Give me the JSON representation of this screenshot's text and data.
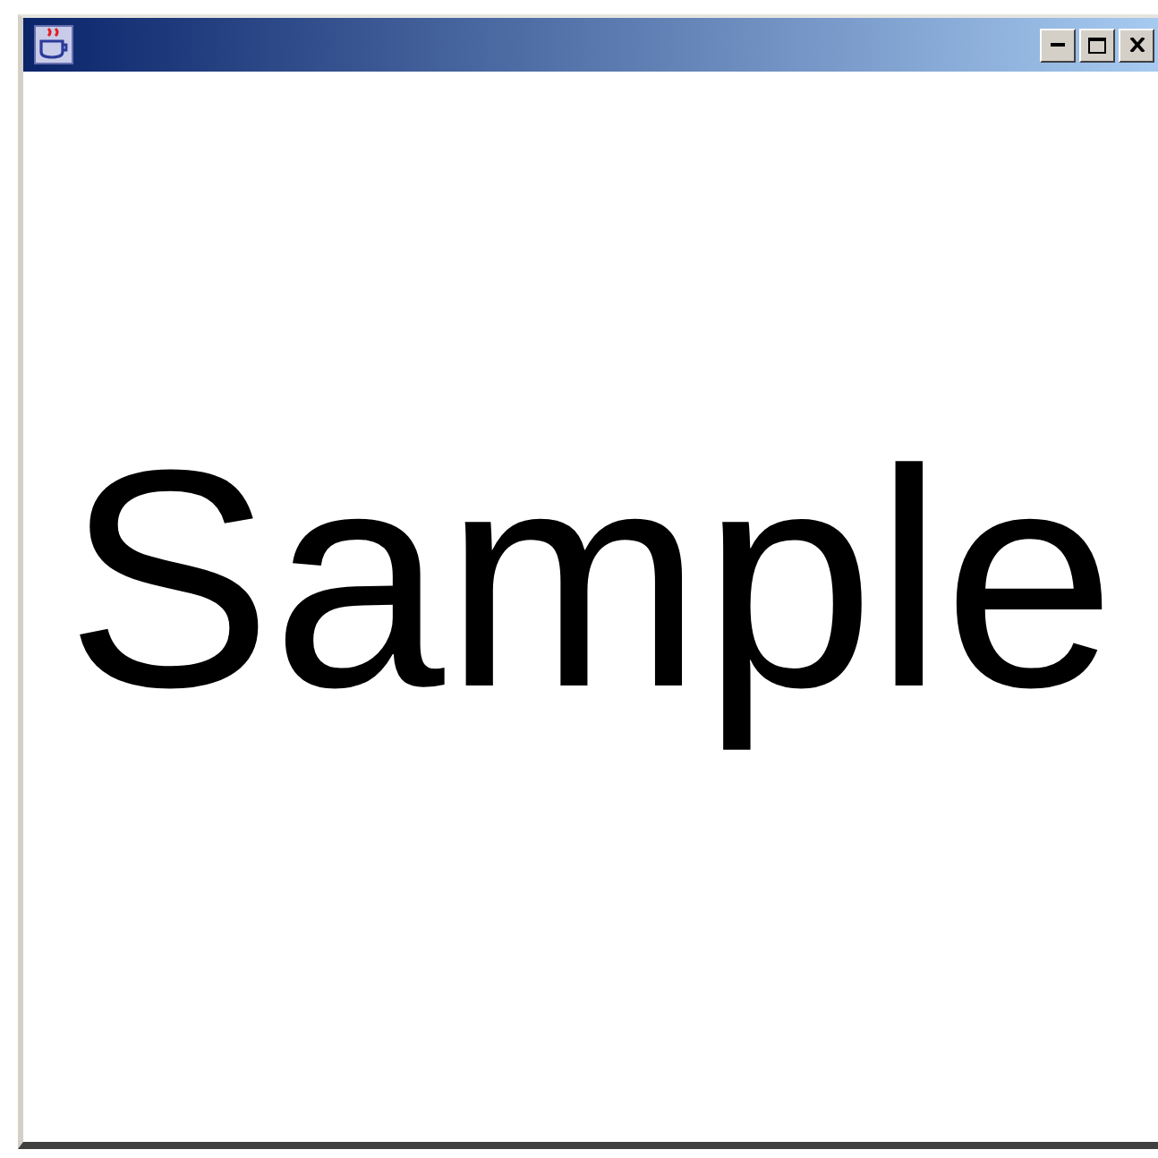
{
  "window": {
    "controls": [
      {
        "kind": "minimize"
      },
      {
        "kind": "maximize"
      },
      {
        "kind": "close"
      }
    ]
  },
  "content": {
    "text": "Sample"
  }
}
